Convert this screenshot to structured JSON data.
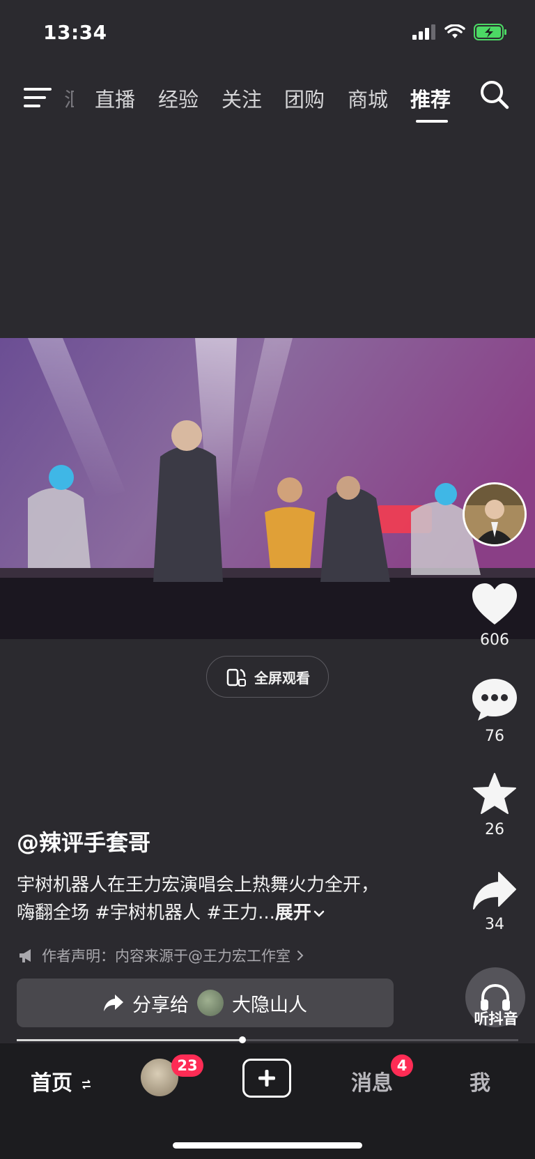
{
  "status_bar": {
    "time": "13:34",
    "battery": "charging"
  },
  "top_tabs": {
    "partial_label": "汇",
    "tabs": [
      "直播",
      "经验",
      "关注",
      "团购",
      "商城",
      "推荐"
    ],
    "active_index": 5
  },
  "video": {
    "fullscreen_label": "全屏观看"
  },
  "actions": {
    "likes": "606",
    "comments": "76",
    "favorites": "26",
    "shares": "34",
    "listen_label": "听抖音"
  },
  "post": {
    "author": "@辣评手套哥",
    "description": "宇树机器人在王力宏演唱会上热舞火力全开，嗨翻全场 #宇树机器人 #王力...",
    "expand_label": "展开",
    "declaration": "作者声明：内容来源于@王力宏工作室"
  },
  "share_bar": {
    "label": "分享给",
    "friend_name": "大隐山人"
  },
  "progress": {
    "fraction": 0.45
  },
  "bottom_nav": {
    "home": "首页",
    "friends_badge": "23",
    "messages": "消息",
    "messages_badge": "4",
    "me": "我"
  },
  "colors": {
    "accent": "#fe2c55",
    "background": "#2b2a2f",
    "nav_bg": "#1c1c1f"
  }
}
